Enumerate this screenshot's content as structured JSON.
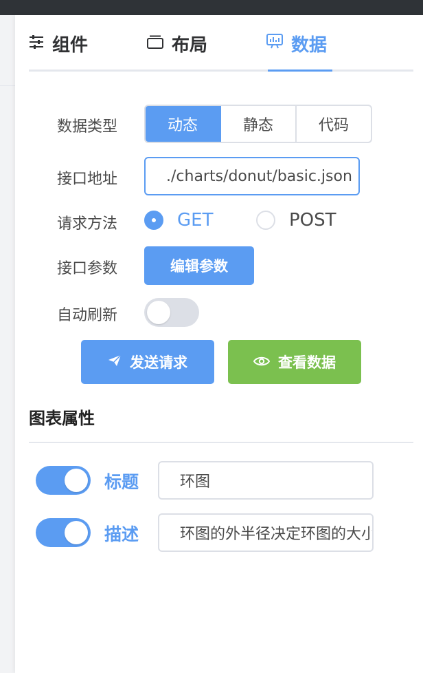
{
  "tabs": [
    {
      "label": "组件",
      "icon": "sliders-icon",
      "active": false
    },
    {
      "label": "布局",
      "icon": "layout-icon",
      "active": false
    },
    {
      "label": "数据",
      "icon": "chart-icon",
      "active": true
    }
  ],
  "data_source": {
    "type_label": "数据类型",
    "types": [
      "动态",
      "静态",
      "代码"
    ],
    "selected_type": "动态",
    "url_label": "接口地址",
    "url_value": "./charts/donut/basic.json",
    "method_label": "请求方法",
    "methods": [
      "GET",
      "POST"
    ],
    "selected_method": "GET",
    "params_label": "接口参数",
    "params_button": "编辑参数",
    "auto_refresh_label": "自动刷新",
    "auto_refresh": false,
    "send_button": "发送请求",
    "view_button": "查看数据"
  },
  "chart_props": {
    "section_title": "图表属性",
    "title_label": "标题",
    "title_enabled": true,
    "title_value": "环图",
    "desc_label": "描述",
    "desc_enabled": true,
    "desc_value": "环图的外半径决定环图的大小"
  },
  "colors": {
    "primary": "#5b9cf2",
    "success": "#7bc04f",
    "topbar": "#2f3337"
  }
}
